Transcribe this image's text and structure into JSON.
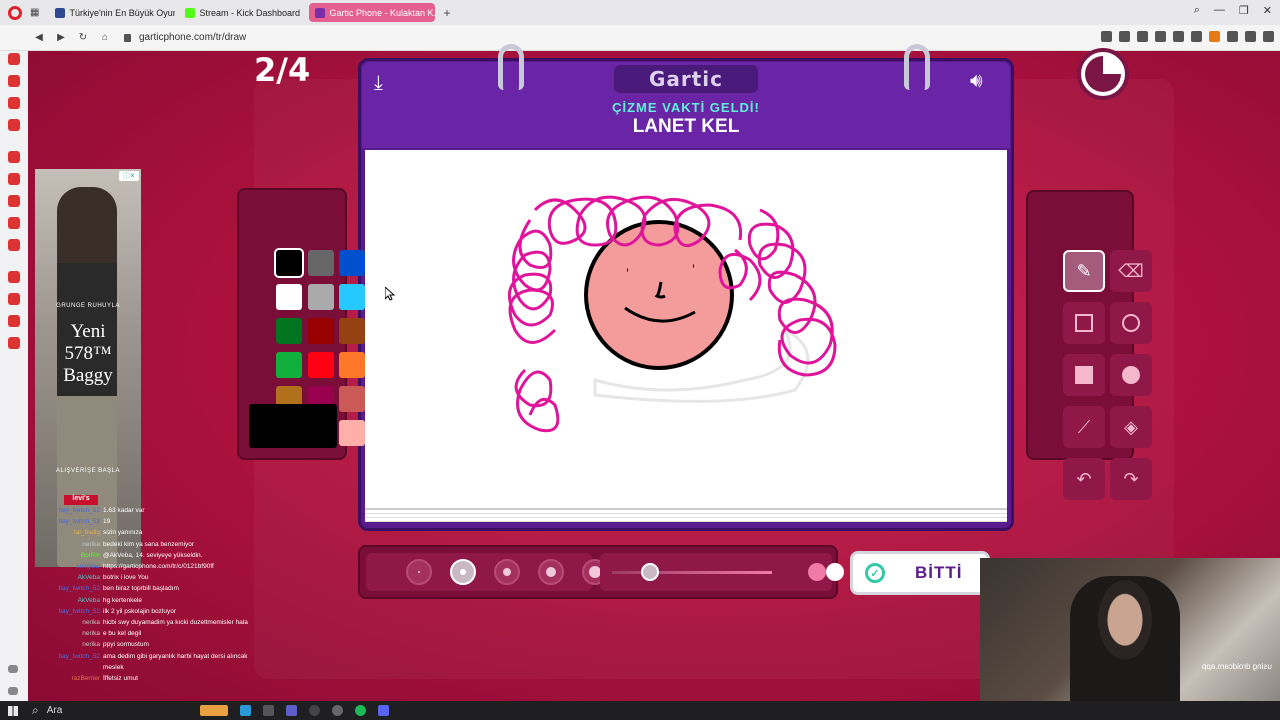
{
  "browser": {
    "tabs": [
      {
        "label": "Türkiye'nin En Büyük Oyun",
        "color": "#2e4a8e"
      },
      {
        "label": "Stream - Kick Dashboard",
        "color": "#53fc18"
      },
      {
        "label": "Gartic Phone - Kulaktan K...",
        "color": "#7a2ea8"
      }
    ],
    "new_tab": "+",
    "url": "garticphone.com/tr/draw"
  },
  "game": {
    "round": "2/4",
    "logo": "Gartic",
    "subtitle": "ÇİZME VAKTİ GELDİ!",
    "word": "LANET KEL",
    "done_label": "BİTTİ",
    "palette": [
      "#000000",
      "#666666",
      "#0050cd",
      "#ffffff",
      "#aaaaaa",
      "#26c9ff",
      "#017420",
      "#990000",
      "#964112",
      "#11b03c",
      "#ff0013",
      "#ff7829",
      "#b0701c",
      "#99004e",
      "#cb5a57",
      "#ffc126",
      "#ff008f",
      "#feafa8"
    ],
    "selected_color": "#000000",
    "brush_sizes": 5,
    "selected_size_index": 1,
    "opacity": 0.9
  },
  "tools": [
    "pen-icon",
    "eraser-icon",
    "square-outline-icon",
    "circle-outline-icon",
    "square-filled-icon",
    "circle-filled-icon",
    "line-icon",
    "fill-bucket-icon",
    "undo-icon",
    "redo-icon"
  ],
  "ad": {
    "tagline_top": "GRUNGE RUHUYLA",
    "product_line1": "Yeni",
    "product_line2": "578™",
    "product_line3": "Baggy",
    "cta": "ALIŞVERİŞE BAŞLA",
    "brand": "levi's"
  },
  "chat": [
    {
      "user": "bay_twitch_52",
      "msg": "1.63 kadar var",
      "color": "#4a6bd8"
    },
    {
      "user": "bay_twitch_52",
      "msg": "19",
      "color": "#4a6bd8"
    },
    {
      "user": "tal_bsdig",
      "msg": "sizin yanınıza",
      "color": "#e8b24a"
    },
    {
      "user": "nerika",
      "msg": "bedeki kim ya sana benzemiyor",
      "color": "#c8c8c8"
    },
    {
      "user": "BotRix",
      "msg": "@AkVeba, 14. seviyeye yükseldin.",
      "color": "#53fc18"
    },
    {
      "user": "lastglow",
      "msg": "https://garticphone.com/tr/c/0121bf90ff",
      "color": "#4a6bd8"
    },
    {
      "user": "AkVeba",
      "msg": "botrix i love You",
      "color": "#53c8c8"
    },
    {
      "user": "bay_twitch_52",
      "msg": "ben biraz toprbill başladım",
      "color": "#4a6bd8"
    },
    {
      "user": "AkVeba",
      "msg": "hg kertenkele",
      "color": "#53c8c8"
    },
    {
      "user": "bay_twitch_52",
      "msg": "ilk 2 yil pskolajin bozluyor",
      "color": "#4a6bd8"
    },
    {
      "user": "nerika",
      "msg": "hicbi swy duyamadim ya kıcki duzeltmemisler hala",
      "color": "#c8c8c8"
    },
    {
      "user": "nerika",
      "msg": "e bu kel degil",
      "color": "#c8c8c8"
    },
    {
      "user": "nerika",
      "msg": "ppyi sormustum",
      "color": "#c8c8c8"
    },
    {
      "user": "bay_twitch_52",
      "msg": "ama dedim gibi garyanlık harbi hayat dersi alıncak meslek",
      "color": "#4a6bd8"
    },
    {
      "user": "razBerrier",
      "msg": "İffetsiz umut",
      "color": "#e8704a"
    }
  ],
  "taskbar": {
    "search_label": "Ara"
  },
  "webcam": {
    "watermark": "using droidcam.app"
  }
}
